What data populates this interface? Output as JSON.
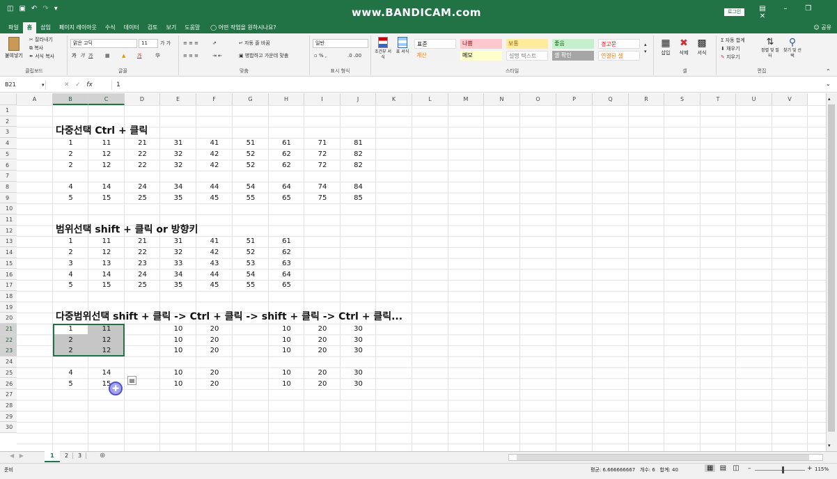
{
  "titlebar": {
    "title": "www.BANDICAM.com",
    "login_label": "로그인"
  },
  "ribbon_tabs": [
    "파일",
    "홈",
    "삽입",
    "페이지 레이아웃",
    "수식",
    "데이터",
    "검토",
    "보기",
    "도움말"
  ],
  "tell_me": "어떤 작업을 원하시나요?",
  "share_label": "공유",
  "clipboard": {
    "paste": "붙여넣기",
    "cut": "잘라내기",
    "copy": "복사",
    "format_painter": "서식 복사",
    "group": "클립보드"
  },
  "font": {
    "name": "맑은 고딕",
    "size": "11",
    "group": "글꼴"
  },
  "alignment": {
    "wrap": "자동 줄 바꿈",
    "merge": "병합하고 가운데 맞춤",
    "group": "맞춤"
  },
  "number": {
    "format": "일반",
    "group": "표시 형식"
  },
  "styles": {
    "conditional": "조건부 서식",
    "table": "표 서식",
    "cells": [
      {
        "label": "표준",
        "bg": "#ffffff",
        "fg": "#000000"
      },
      {
        "label": "나쁨",
        "bg": "#ffc7ce",
        "fg": "#9c0006"
      },
      {
        "label": "보통",
        "bg": "#ffeb9c",
        "fg": "#9c5700"
      },
      {
        "label": "좋음",
        "bg": "#c6efce",
        "fg": "#006100"
      },
      {
        "label": "경고문",
        "bg": "#ffffff",
        "fg": "#ff0000"
      },
      {
        "label": "계산",
        "bg": "#f2f2f2",
        "fg": "#fa7d00"
      },
      {
        "label": "메모",
        "bg": "#ffffcc",
        "fg": "#000000"
      },
      {
        "label": "설명 텍스트",
        "bg": "#ffffff",
        "fg": "#7f7f7f"
      },
      {
        "label": "셀 확인",
        "bg": "#a5a5a5",
        "fg": "#ffffff"
      },
      {
        "label": "연결된 셀",
        "bg": "#ffffff",
        "fg": "#fa7d00"
      }
    ],
    "group": "스타일"
  },
  "cells_group": {
    "insert": "삽입",
    "delete": "삭제",
    "format": "서식",
    "group": "셀"
  },
  "editing": {
    "autosum": "자동 합계",
    "fill": "채우기",
    "clear": "지우기",
    "sort": "정렬 및 필터",
    "find": "찾기 및 선택",
    "group": "편집"
  },
  "formula_bar": {
    "name_box": "B21",
    "value": "1",
    "fx": "fx"
  },
  "columns": [
    "A",
    "B",
    "C",
    "D",
    "E",
    "F",
    "G",
    "H",
    "I",
    "J",
    "K",
    "L",
    "M",
    "N",
    "O",
    "P",
    "Q",
    "R",
    "S",
    "T",
    "U",
    "V"
  ],
  "rows": [
    "1",
    "2",
    "3",
    "4",
    "5",
    "6",
    "7",
    "8",
    "9",
    "10",
    "11",
    "12",
    "13",
    "14",
    "15",
    "16",
    "17",
    "18",
    "19",
    "20",
    "21",
    "22",
    "23",
    "24",
    "25",
    "26",
    "27",
    "28",
    "29",
    "30"
  ],
  "section_headers": [
    {
      "row": 3,
      "text": "다중선택 Ctrl + 클릭"
    },
    {
      "row": 12,
      "text": "범위선택 shift + 클릭 or 방향키"
    },
    {
      "row": 20,
      "text": "다중범위선택 shift + 클릭 -> Ctrl + 클릭 -> shift + 클릭 -> Ctrl + 클릭..."
    }
  ],
  "cell_rows": [
    {
      "row": 4,
      "cols": [
        "B",
        "C",
        "D",
        "E",
        "F",
        "G",
        "H",
        "I",
        "J"
      ],
      "values": [
        "1",
        "11",
        "21",
        "31",
        "41",
        "51",
        "61",
        "71",
        "81"
      ]
    },
    {
      "row": 5,
      "cols": [
        "B",
        "C",
        "D",
        "E",
        "F",
        "G",
        "H",
        "I",
        "J"
      ],
      "values": [
        "2",
        "12",
        "22",
        "32",
        "42",
        "52",
        "62",
        "72",
        "82"
      ]
    },
    {
      "row": 6,
      "cols": [
        "B",
        "C",
        "D",
        "E",
        "F",
        "G",
        "H",
        "I",
        "J"
      ],
      "values": [
        "2",
        "12",
        "22",
        "32",
        "42",
        "52",
        "62",
        "72",
        "82"
      ]
    },
    {
      "row": 8,
      "cols": [
        "B",
        "C",
        "D",
        "E",
        "F",
        "G",
        "H",
        "I",
        "J"
      ],
      "values": [
        "4",
        "14",
        "24",
        "34",
        "44",
        "54",
        "64",
        "74",
        "84"
      ]
    },
    {
      "row": 9,
      "cols": [
        "B",
        "C",
        "D",
        "E",
        "F",
        "G",
        "H",
        "I",
        "J"
      ],
      "values": [
        "5",
        "15",
        "25",
        "35",
        "45",
        "55",
        "65",
        "75",
        "85"
      ]
    },
    {
      "row": 13,
      "cols": [
        "B",
        "C",
        "D",
        "E",
        "F",
        "G",
        "H"
      ],
      "values": [
        "1",
        "11",
        "21",
        "31",
        "41",
        "51",
        "61"
      ]
    },
    {
      "row": 14,
      "cols": [
        "B",
        "C",
        "D",
        "E",
        "F",
        "G",
        "H"
      ],
      "values": [
        "2",
        "12",
        "22",
        "32",
        "42",
        "52",
        "62"
      ]
    },
    {
      "row": 15,
      "cols": [
        "B",
        "C",
        "D",
        "E",
        "F",
        "G",
        "H"
      ],
      "values": [
        "3",
        "13",
        "23",
        "33",
        "43",
        "53",
        "63"
      ]
    },
    {
      "row": 16,
      "cols": [
        "B",
        "C",
        "D",
        "E",
        "F",
        "G",
        "H"
      ],
      "values": [
        "4",
        "14",
        "24",
        "34",
        "44",
        "54",
        "64"
      ]
    },
    {
      "row": 17,
      "cols": [
        "B",
        "C",
        "D",
        "E",
        "F",
        "G",
        "H"
      ],
      "values": [
        "5",
        "15",
        "25",
        "35",
        "45",
        "55",
        "65"
      ]
    },
    {
      "row": 21,
      "cols": [
        "B",
        "C",
        "E",
        "F",
        "H",
        "I",
        "J"
      ],
      "values": [
        "1",
        "11",
        "10",
        "20",
        "10",
        "20",
        "30"
      ]
    },
    {
      "row": 22,
      "cols": [
        "B",
        "C",
        "E",
        "F",
        "H",
        "I",
        "J"
      ],
      "values": [
        "2",
        "12",
        "10",
        "20",
        "10",
        "20",
        "30"
      ]
    },
    {
      "row": 23,
      "cols": [
        "B",
        "C",
        "E",
        "F",
        "H",
        "I",
        "J"
      ],
      "values": [
        "2",
        "12",
        "10",
        "20",
        "10",
        "20",
        "30"
      ]
    },
    {
      "row": 25,
      "cols": [
        "B",
        "C",
        "E",
        "F",
        "H",
        "I",
        "J"
      ],
      "values": [
        "4",
        "14",
        "10",
        "20",
        "10",
        "20",
        "30"
      ]
    },
    {
      "row": 26,
      "cols": [
        "B",
        "C",
        "E",
        "F",
        "H",
        "I",
        "J"
      ],
      "values": [
        "5",
        "15",
        "10",
        "20",
        "10",
        "20",
        "30"
      ]
    }
  ],
  "sheet_tabs": [
    "1",
    "2",
    "3"
  ],
  "status": {
    "ready": "준비",
    "average": "평균: 6.666666667",
    "count": "개수: 6",
    "sum": "합계: 40",
    "zoom": "115%"
  },
  "colors": {
    "accent": "#217346",
    "selection": "#c6c6c6"
  }
}
